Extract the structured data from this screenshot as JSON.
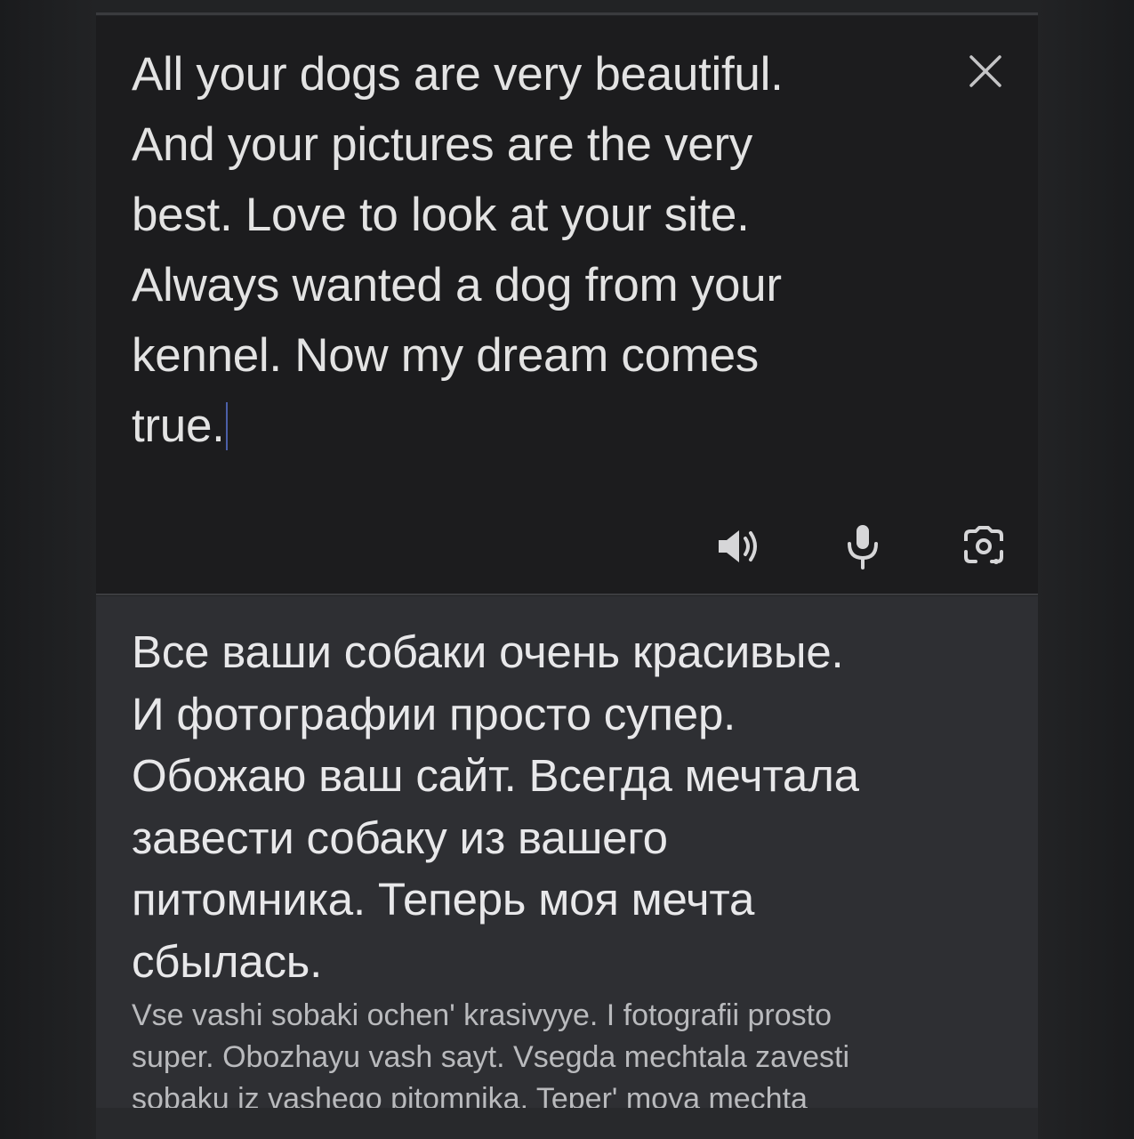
{
  "source": {
    "text": "All your dogs are very beautiful.\nAnd your pictures are the very\nbest. Love to look at your site.\nAlways wanted a dog from your\nkennel. Now my dream comes\ntrue.",
    "clear_icon": "close-icon",
    "tools": [
      {
        "name": "listen",
        "icon": "speaker-icon"
      },
      {
        "name": "microphone",
        "icon": "mic-icon"
      },
      {
        "name": "camera",
        "icon": "camera-icon"
      }
    ]
  },
  "translation": {
    "text": "Все ваши собаки очень красивые.\nИ фотографии просто супер.\nОбожаю ваш сайт. Всегда мечтала\nзавести собаку из вашего\nпитомника. Теперь моя мечта\nсбылась.",
    "transliteration": "Vse vashi sobaki ochen' krasivyye. I fotografii prosto\nsuper. Obozhayu vash sayt. Vsegda mechtala zavesti\nsobaku iz vashego pitomnika. Teper' moya mechta"
  },
  "colors": {
    "source_panel": "#1c1c1e",
    "target_panel": "#2e2f33",
    "text": "#e3e3e3",
    "caret": "#4b5fa8"
  }
}
